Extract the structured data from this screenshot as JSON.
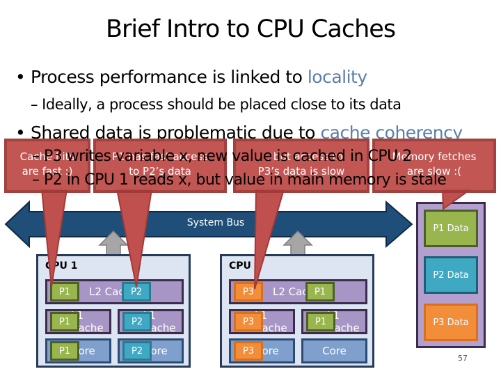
{
  "slide": {
    "title": "Brief Intro to CPU Caches",
    "page_number": "57"
  },
  "bullets": [
    {
      "text": "Process performance is linked to ",
      "accent": "locality",
      "sub": [
        "– Ideally, a process should be placed close to its data"
      ]
    },
    {
      "text": "Shared data is problematic due to ",
      "accent": "cache coherency",
      "sub": [
        "– P3 writes variable x, new value is cached in CPU 2",
        "– P2 in CPU 1 reads x, but value in main memory is stale"
      ]
    }
  ],
  "diagram": {
    "bus_label": "System Bus",
    "cpus": [
      {
        "label": "CPU 1",
        "l2": {
          "text": "L2 Cache",
          "tags": [
            "P1",
            "P2"
          ]
        },
        "l1": [
          {
            "text": "L1 Cache",
            "tag": "P1"
          },
          {
            "text": "L1 Cache",
            "tag": "P2"
          }
        ],
        "cores": [
          {
            "text": "Core",
            "tag": "P1"
          },
          {
            "text": "Core",
            "tag": "P2"
          }
        ]
      },
      {
        "label": "CPU 2",
        "l2": {
          "text": "L2 Cache",
          "tags": [
            "P3",
            "P1"
          ]
        },
        "l1": [
          {
            "text": "L1 Cache",
            "tag": "P3"
          },
          {
            "text": "L1 Cache",
            "tag": "P1"
          }
        ],
        "cores": [
          {
            "text": "Core",
            "tag": "P3"
          },
          {
            "text": "Core",
            "tag": ""
          }
        ]
      }
    ],
    "memory": [
      "P1 Data",
      "P2 Data",
      "P3 Data"
    ]
  },
  "callouts": [
    {
      "line1": "Cache hits",
      "line2": "are fast :)"
    },
    {
      "line1": "P1 has fast access",
      "line2": "to P2’s data"
    },
    {
      "line1": "… but access to",
      "line2": "P3’s data is slow"
    },
    {
      "line1": "Memory fetches",
      "line2": "are slow :("
    }
  ],
  "colors": {
    "accent_text": "#5b7fa8",
    "callout": "#c0504d",
    "bus": "#1f4e79",
    "p1": "#98b54e",
    "p2": "#3fa8c2",
    "p3": "#f28d3a",
    "cache": "#a796c5",
    "core": "#7f9fcc"
  }
}
